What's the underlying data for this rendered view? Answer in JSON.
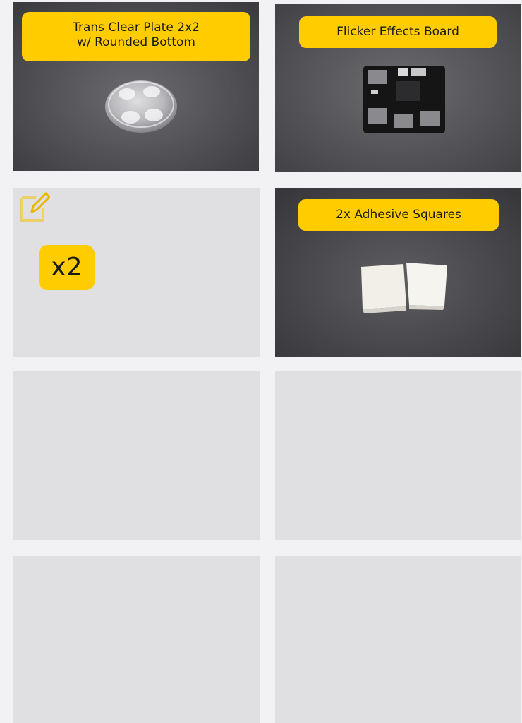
{
  "cards": [
    {
      "label_line1": "Trans Clear Plate 2x2",
      "label_line2": "w/ Rounded Bottom"
    },
    {
      "label": "Flicker Effects Board"
    },
    {
      "icon": "edit-note-icon",
      "quantity": "x2"
    },
    {
      "label": "2x Adhesive Squares"
    }
  ],
  "colors": {
    "accent": "#ffcc00",
    "page_bg": "#f2f2f4",
    "placeholder_bg": "#e0e0e2",
    "photo_bg": "#4b4b4f"
  }
}
